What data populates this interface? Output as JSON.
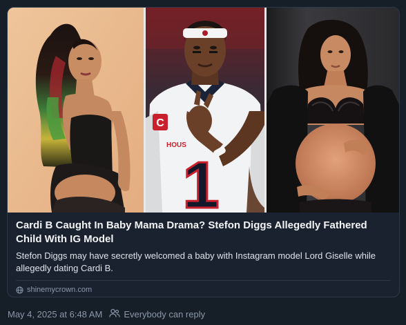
{
  "link_card": {
    "title": "Cardi B Caught In Baby Mama Drama? Stefon Diggs Allegedly Fathered Child With IG Model",
    "description": "Stefon Diggs may have secretly welcomed a baby with Instagram model Lord Giselle while allegedly dating Cardi B.",
    "domain": "shinemycrown.com",
    "domain_icon": "globe-icon",
    "thumbnail": {
      "panels": [
        "woman-with-multicolor-hair",
        "football-player-in-jersey",
        "pregnant-woman-in-lingerie"
      ],
      "jersey_number": "1",
      "jersey_text": "HOUS",
      "jersey_badge": "C"
    }
  },
  "post_meta": {
    "timestamp": "May 4, 2025 at 6:48 AM",
    "reply_setting": "Everybody can reply",
    "reply_icon": "people-icon"
  },
  "colors": {
    "background": "#161e27",
    "card_border": "#2c3948",
    "text_primary": "#f1f3f5",
    "text_muted": "#8b98a9"
  }
}
